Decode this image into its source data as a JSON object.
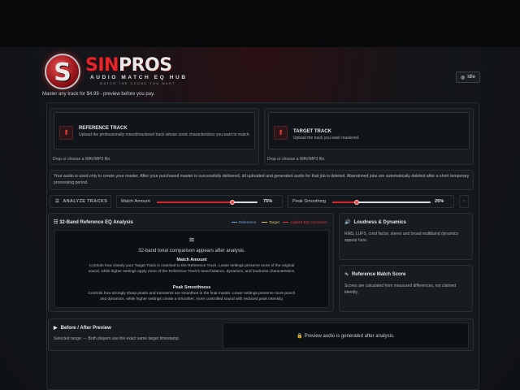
{
  "brand": {
    "logo_mark": "S",
    "logo_word_part1": "SIN",
    "logo_word_part2": "PROS",
    "logo_sub": "AUDIO MATCH EQ HUB",
    "logo_tag": "MATCH THE SOUND YOU WANT",
    "tagline": "Master any track for $4.99 - preview before you pay."
  },
  "status": {
    "label": "Idle",
    "icon": "status-dot-icon"
  },
  "upload": {
    "reference": {
      "title": "REFERENCE TRACK",
      "desc": "Upload the professionally mixed/mastered track whose sonic characteristics you want to match.",
      "hint": "Drop or choose a WAV/MP3 file.",
      "icon": "upload-icon"
    },
    "target": {
      "title": "TARGET TRACK",
      "desc": "Upload the track you want mastered.",
      "hint": "Drop or choose a WAV/MP3 file.",
      "icon": "upload-icon"
    }
  },
  "notice": "Your audio is used only to create your master. After your purchased master is successfully delivered, all uploaded and generated audio for that job is deleted. Abandoned jobs are automatically deleted after a short temporary processing period.",
  "controls": {
    "analyze_label": "ANALYZE TRACKS",
    "match_amount": {
      "label": "Match Amount",
      "value_text": "75%",
      "value": 0.75
    },
    "peak_smoothing": {
      "label": "Peak Smoothing",
      "value_text": "25%",
      "value": 0.25
    }
  },
  "eq": {
    "title": "32-Band Reference EQ Analysis",
    "legend": [
      {
        "label": "Reference",
        "color": "#6aa9e0"
      },
      {
        "label": "Target",
        "color": "#d8c060"
      },
      {
        "label": "Applied EQ Correction",
        "color": "#e0383d"
      }
    ],
    "empty_msg": "32-band tonal comparison appears after analysis.",
    "match_heading": "Match Amount",
    "match_desc": "Controls how closely your Target Track is matched to the Reference Track. Lower settings preserve more of the original sound, while higher settings apply more of the Reference Track's tonal balance, dynamics, and loudness characteristics.",
    "peak_heading": "Peak Smoothness",
    "peak_desc": "Controls how strongly sharp peaks and transients are smoothed in the final master. Lower settings preserve more punch and dynamics, while higher settings create a smoother, more controlled sound with reduced peak intensity."
  },
  "loudness": {
    "title": "Loudness & Dynamics",
    "desc": "RMS, LUFS, crest factor, stereo and broad multiband dynamics appear here."
  },
  "score": {
    "title": "Reference Match Score",
    "desc": "Scores are calculated from measured differences, not claimed identity."
  },
  "before_after": {
    "title": "Before / After Preview",
    "desc": "Selected range: --. Both players use the exact same target timestamp.",
    "preview_msg": "Preview audio is generated after analysis."
  }
}
